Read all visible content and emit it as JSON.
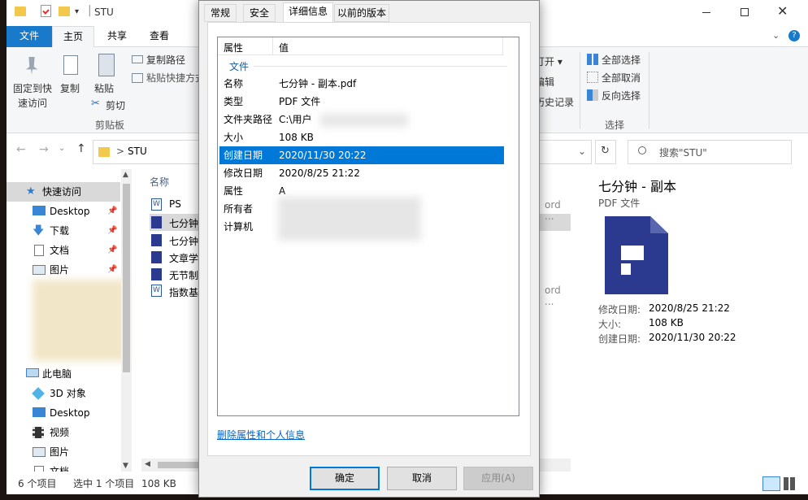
{
  "explorer": {
    "title": "STU",
    "qat_folder": "❑",
    "tabs": [
      "文件",
      "主页",
      "共享",
      "查看"
    ],
    "ribbon": {
      "pin_quick_access_1": "固定到快",
      "pin_quick_access_2": "速访问",
      "copy": "复制",
      "paste": "粘贴",
      "copy_path": "复制路径",
      "paste_shortcut": "粘贴快捷方式",
      "cut": "剪切",
      "clipboard_group": "剪贴板",
      "open": "打开 ▾",
      "edit": "编辑",
      "history": "历史记录",
      "select_all": "全部选择",
      "select_none": "全部取消",
      "invert_selection": "反向选择",
      "select_group": "选择"
    },
    "address": {
      "path": "STU",
      "separator": ">",
      "search_placeholder": "搜索\"STU\""
    },
    "nav": {
      "quick_access": "快速访问",
      "items": [
        "Desktop",
        "下载",
        "文档",
        "图片"
      ],
      "this_pc": "此电脑",
      "pc_items": [
        "3D 对象",
        "Desktop",
        "视频",
        "图片",
        "文档"
      ]
    },
    "files": {
      "header_name": "名称",
      "items": [
        "PS",
        "七分钟",
        "七分钟",
        "文章学",
        "无节制",
        "指数基"
      ],
      "partial_right_1": "ord ...",
      "partial_right_2": "ord ..."
    },
    "preview": {
      "title": "七分钟 - 副本",
      "type": "PDF 文件",
      "modified_label": "修改日期:",
      "modified_value": "2020/8/25 21:22",
      "size_label": "大小:",
      "size_value": "108 KB",
      "created_label": "创建日期:",
      "created_value": "2020/11/30 20:22"
    },
    "status": {
      "count": "6 个项目",
      "selected": "选中 1 个项目",
      "size": "108 KB"
    }
  },
  "dialog": {
    "tabs": [
      "常规",
      "安全",
      "详细信息",
      "以前的版本"
    ],
    "header_property": "属性",
    "header_value": "值",
    "section": "文件",
    "rows": [
      {
        "k": "名称",
        "v": "七分钟 - 副本.pdf"
      },
      {
        "k": "类型",
        "v": "PDF 文件"
      },
      {
        "k": "文件夹路径",
        "v": "C:\\用户"
      },
      {
        "k": "大小",
        "v": "108 KB"
      },
      {
        "k": "创建日期",
        "v": "2020/11/30 20:22"
      },
      {
        "k": "修改日期",
        "v": "2020/8/25 21:22"
      },
      {
        "k": "属性",
        "v": "A"
      },
      {
        "k": "所有者",
        "v": ""
      },
      {
        "k": "计算机",
        "v": ""
      }
    ],
    "remove_link": "删除属性和个人信息",
    "ok": "确定",
    "cancel": "取消",
    "apply": "应用(A)"
  },
  "colors": {
    "accent": "#0078d7",
    "pdf_icon": "#2b3a8f",
    "selection": "#cce8ff"
  }
}
